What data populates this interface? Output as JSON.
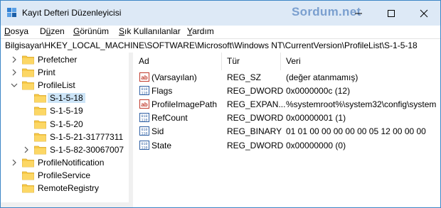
{
  "window": {
    "title": "Kayıt Defteri Düzenleyicisi",
    "watermark": "Sordum.net",
    "accent": "#dde9f6"
  },
  "titlebar_buttons": [
    {
      "name": "minimize-icon"
    },
    {
      "name": "maximize-icon"
    },
    {
      "name": "close-icon"
    }
  ],
  "menu": [
    {
      "label": "Dosya",
      "key": "D",
      "rest": "osya"
    },
    {
      "label": "Düzen",
      "key": "ü",
      "pre": "D",
      "rest": "zen"
    },
    {
      "label": "Görünüm",
      "key": "G",
      "rest": "örünüm"
    },
    {
      "label": "Sık Kullanılanlar",
      "key": "S",
      "rest": "ık Kullanılanlar"
    },
    {
      "label": "Yardım",
      "key": "Y",
      "rest": "ardım"
    }
  ],
  "address": "Bilgisayar\\HKEY_LOCAL_MACHINE\\SOFTWARE\\Microsoft\\Windows NT\\CurrentVersion\\ProfileList\\S-1-5-18",
  "tree": [
    {
      "label": "Prefetcher",
      "expander": "collapsed",
      "depth": 0
    },
    {
      "label": "Print",
      "expander": "collapsed",
      "depth": 0
    },
    {
      "label": "ProfileList",
      "expander": "expanded",
      "depth": 0
    },
    {
      "label": "S-1-5-18",
      "expander": "none",
      "depth": 1,
      "selected": true
    },
    {
      "label": "S-1-5-19",
      "expander": "none",
      "depth": 1
    },
    {
      "label": "S-1-5-20",
      "expander": "none",
      "depth": 1
    },
    {
      "label": "S-1-5-21-31777311",
      "expander": "none",
      "depth": 1
    },
    {
      "label": "S-1-5-82-30067007",
      "expander": "collapsed",
      "depth": 1
    },
    {
      "label": "ProfileNotification",
      "expander": "collapsed",
      "depth": 0
    },
    {
      "label": "ProfileService",
      "expander": "none",
      "depth": 0
    },
    {
      "label": "RemoteRegistry",
      "expander": "none",
      "depth": 0
    }
  ],
  "columns": {
    "name": "Ad",
    "type": "Tür",
    "data": "Veri"
  },
  "values": [
    {
      "icon": "string-value-icon",
      "name": "(Varsayılan)",
      "type": "REG_SZ",
      "data": "(değer atanmamış)"
    },
    {
      "icon": "binary-value-icon",
      "name": "Flags",
      "type": "REG_DWORD",
      "data": "0x0000000c (12)"
    },
    {
      "icon": "string-value-icon",
      "name": "ProfileImagePath",
      "type": "REG_EXPAN...",
      "data": "%systemroot%\\system32\\config\\system"
    },
    {
      "icon": "binary-value-icon",
      "name": "RefCount",
      "type": "REG_DWORD",
      "data": "0x00000001 (1)"
    },
    {
      "icon": "binary-value-icon",
      "name": "Sid",
      "type": "REG_BINARY",
      "data": "01 01 00 00 00 00 00 05 12 00 00 00"
    },
    {
      "icon": "binary-value-icon",
      "name": "State",
      "type": "REG_DWORD",
      "data": "0x00000000 (0)"
    }
  ]
}
